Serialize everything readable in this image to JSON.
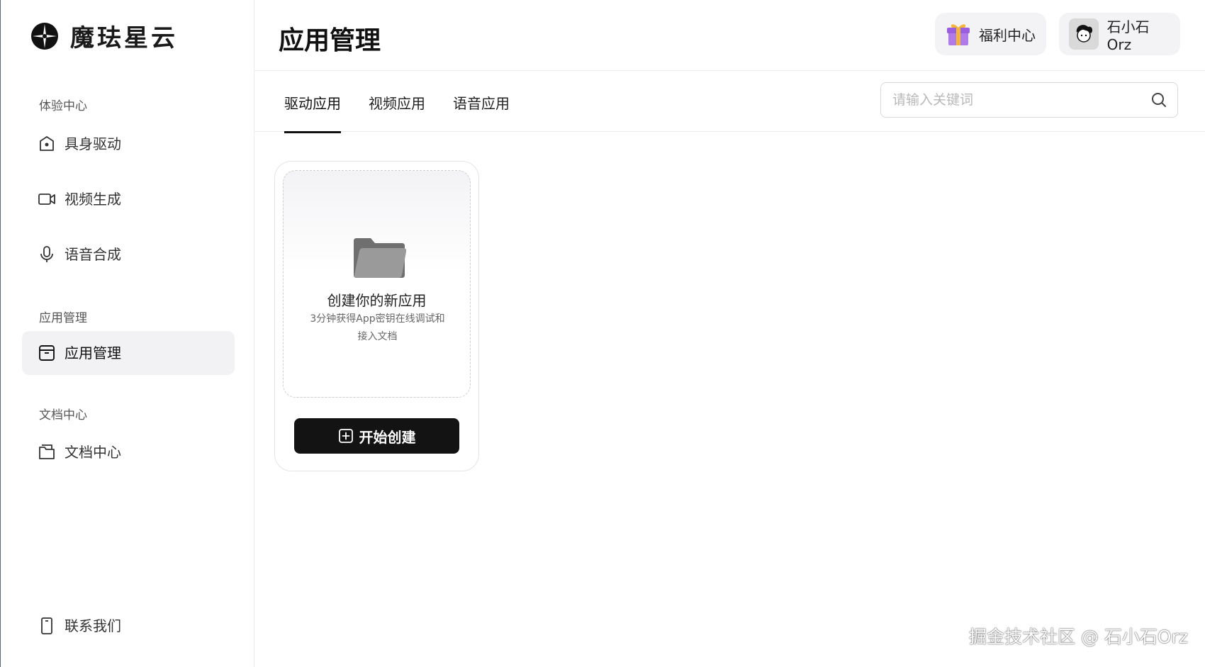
{
  "brand": {
    "name": "魔珐星云",
    "logo_icon": "brand-logo-icon"
  },
  "sidebar": {
    "sections": [
      {
        "label": "体验中心"
      },
      {
        "label": "应用管理"
      },
      {
        "label": "文档中心"
      }
    ],
    "items": [
      {
        "label": "具身驱动",
        "icon": "camera-icon"
      },
      {
        "label": "视频生成",
        "icon": "video-icon"
      },
      {
        "label": "语音合成",
        "icon": "microphone-icon"
      },
      {
        "label": "应用管理",
        "icon": "archive-box-icon",
        "active": true
      },
      {
        "label": "文档中心",
        "icon": "folder-icon"
      }
    ],
    "footer": {
      "label": "联系我们",
      "icon": "phone-icon"
    }
  },
  "header": {
    "title": "应用管理",
    "welfare": {
      "label": "福利中心",
      "icon": "gift-icon"
    },
    "user": {
      "name": "石小石Orz",
      "icon": "avatar"
    }
  },
  "tabs": [
    {
      "label": "驱动应用",
      "active": true
    },
    {
      "label": "视频应用"
    },
    {
      "label": "语音应用"
    }
  ],
  "search": {
    "placeholder": "请输入关键词",
    "value": ""
  },
  "create_card": {
    "title": "创建你的新应用",
    "desc_line1": "3分钟获得App密钥在线调试和",
    "desc_line2": "接入文档",
    "button_label": "开始创建"
  },
  "watermark": "掘金技术社区 @ 石小石Orz",
  "colors": {
    "accent": "#111111",
    "active_bg": "#f2f1f4",
    "border": "#ececec"
  }
}
